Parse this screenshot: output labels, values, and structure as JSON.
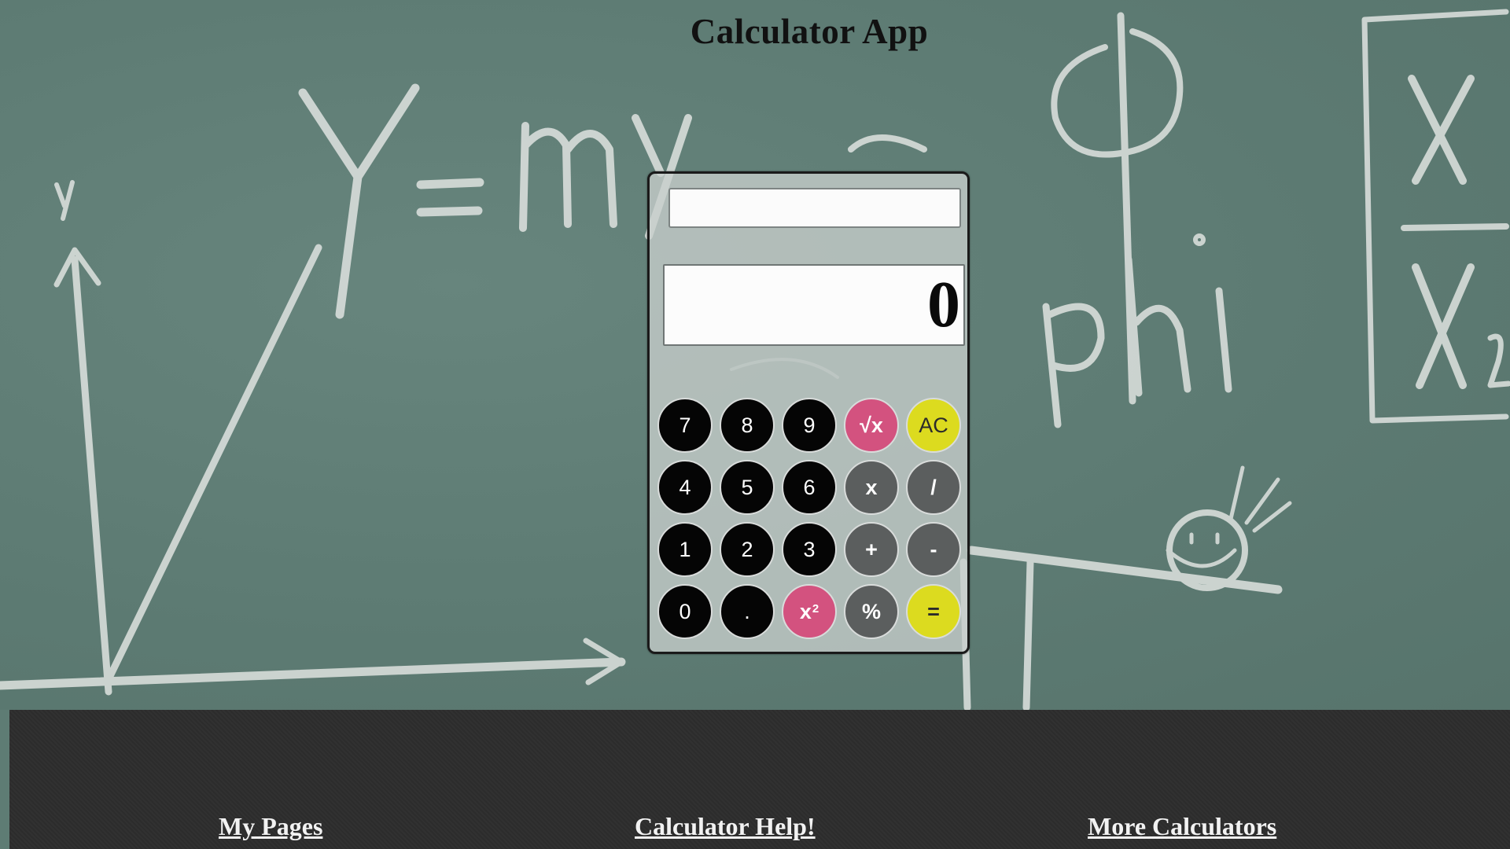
{
  "page": {
    "title": "Calculator App"
  },
  "calculator": {
    "history_value": "",
    "display_value": "0",
    "keys": [
      {
        "label": "7",
        "style": "num"
      },
      {
        "label": "8",
        "style": "num"
      },
      {
        "label": "9",
        "style": "num"
      },
      {
        "label": "√x",
        "style": "pink"
      },
      {
        "label": "AC",
        "style": "yellow"
      },
      {
        "label": "4",
        "style": "num"
      },
      {
        "label": "5",
        "style": "num"
      },
      {
        "label": "6",
        "style": "num"
      },
      {
        "label": "x",
        "style": "op"
      },
      {
        "label": "/",
        "style": "op"
      },
      {
        "label": "1",
        "style": "num"
      },
      {
        "label": "2",
        "style": "num"
      },
      {
        "label": "3",
        "style": "num"
      },
      {
        "label": "+",
        "style": "op"
      },
      {
        "label": "-",
        "style": "op"
      },
      {
        "label": "0",
        "style": "num"
      },
      {
        "label": ".",
        "style": "num"
      },
      {
        "label": "x",
        "superscript": "2",
        "style": "pink"
      },
      {
        "label": "%",
        "style": "op"
      },
      {
        "label": "=",
        "style": "yellow-bold"
      }
    ]
  },
  "footer": {
    "links": [
      {
        "label": "My Pages"
      },
      {
        "label": "Calculator Help!"
      },
      {
        "label": "More Calculators"
      }
    ]
  },
  "colors": {
    "chalkboard": "#5e7c74",
    "footer": "#2c2c2c",
    "number_key": "#050505",
    "operator_key": "#5b5e5e",
    "function_key": "#d3527f",
    "accent_key": "#dcdb1f"
  }
}
